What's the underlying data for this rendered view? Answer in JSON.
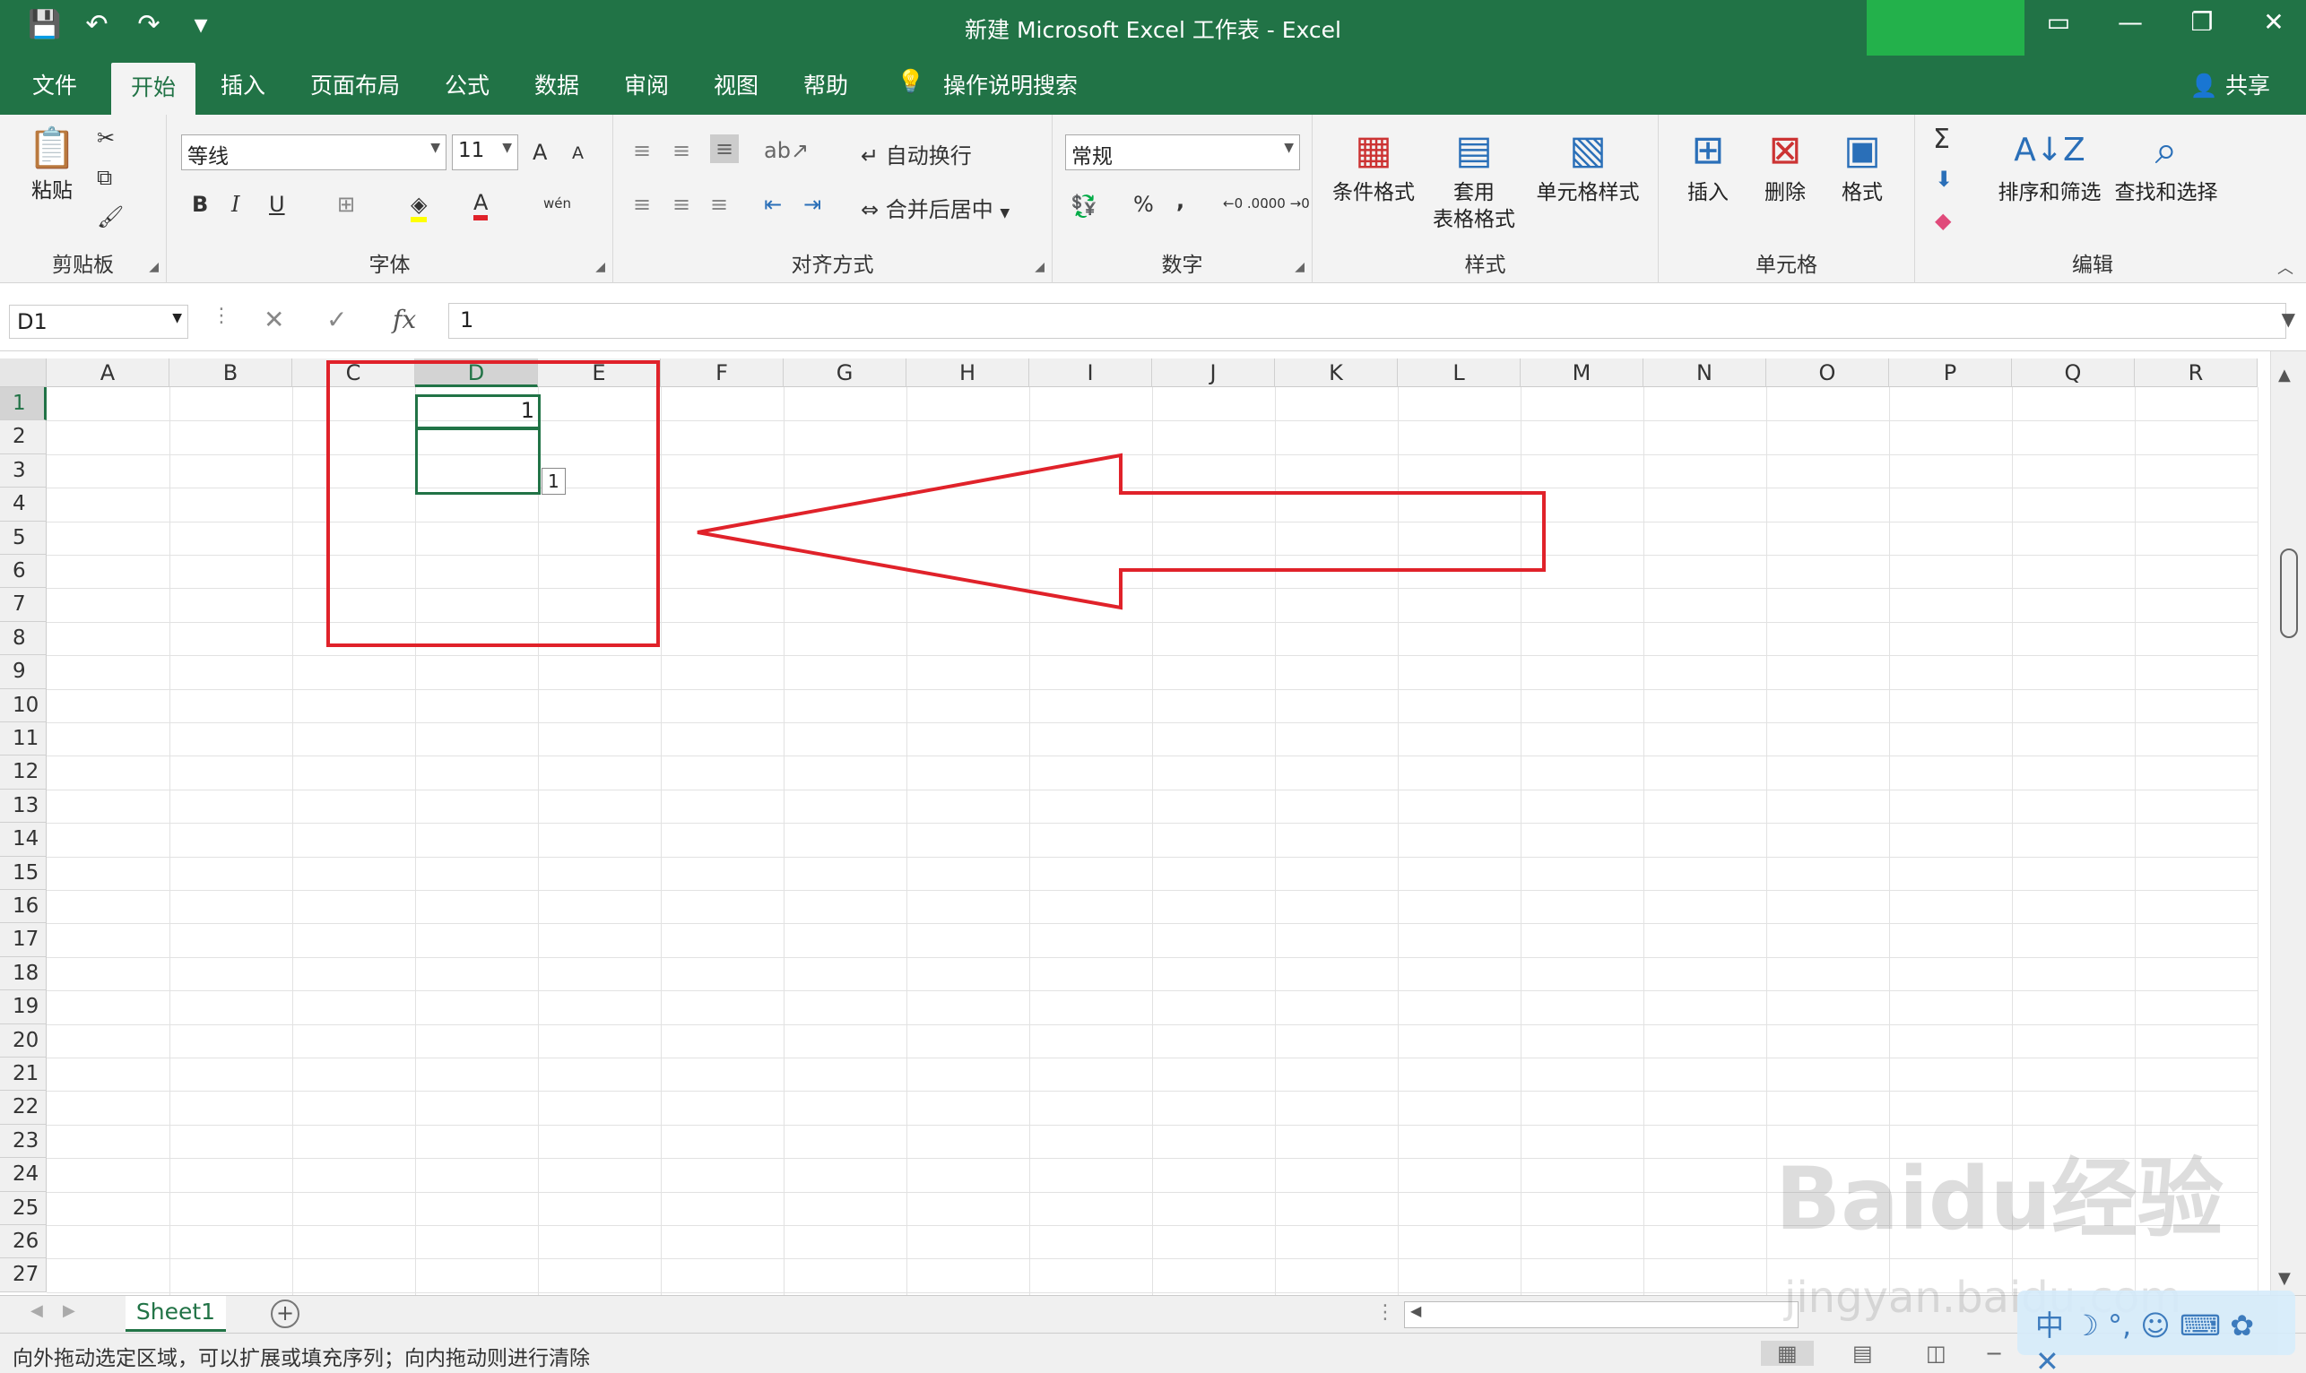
{
  "window": {
    "title": "新建 Microsoft Excel 工作表 - Excel"
  },
  "qat": {
    "save": "save-icon",
    "undo": "undo-icon",
    "redo": "redo-icon",
    "customize": "customize-icon"
  },
  "tabs": [
    "文件",
    "开始",
    "插入",
    "页面布局",
    "公式",
    "数据",
    "审阅",
    "视图",
    "帮助"
  ],
  "search_label": "操作说明搜索",
  "share_label": "共享",
  "ribbon": {
    "clipboard": {
      "label": "剪贴板",
      "paste": "粘贴"
    },
    "font": {
      "label": "字体",
      "name": "等线",
      "size": "11",
      "bold": "B",
      "italic": "I",
      "underline": "U",
      "grow": "A",
      "shrink": "A",
      "color": "A",
      "phonetic": "wén"
    },
    "align": {
      "label": "对齐方式",
      "wrap": "自动换行",
      "merge": "合并后居中"
    },
    "number": {
      "label": "数字",
      "format": "常规",
      "percent": "%",
      "comma": ",",
      "inc": "←0 .00",
      "dec": ".00 →0"
    },
    "styles": {
      "label": "样式",
      "cond": "条件格式",
      "table1": "套用",
      "table2": "表格格式",
      "cell": "单元格样式"
    },
    "cells": {
      "label": "单元格",
      "insert": "插入",
      "delete": "删除",
      "format": "格式"
    },
    "edit": {
      "label": "编辑",
      "sort": "排序和筛选",
      "find": "查找和选择",
      "sum": "Σ"
    }
  },
  "formula_bar": {
    "namebox": "D1",
    "fx": "fx",
    "value": "1"
  },
  "columns": [
    "A",
    "B",
    "C",
    "D",
    "E",
    "F",
    "G",
    "H",
    "I",
    "J",
    "K",
    "L",
    "M",
    "N",
    "O",
    "P",
    "Q",
    "R"
  ],
  "rows": [
    "1",
    "2",
    "3",
    "4",
    "5",
    "6",
    "7",
    "8",
    "9",
    "10",
    "11",
    "12",
    "13",
    "14",
    "15",
    "16",
    "17",
    "18",
    "19",
    "20",
    "21",
    "22",
    "23",
    "24",
    "25",
    "26",
    "27"
  ],
  "cells": {
    "D1": "1"
  },
  "fill_tip": "1",
  "sheet": {
    "name": "Sheet1"
  },
  "status": {
    "text": "向外拖动选定区域，可以扩展或填充序列；向内拖动则进行清除"
  },
  "watermark": {
    "main": "Baidu经验",
    "sub": "jingyan.baidu.com"
  },
  "ime": "中",
  "colors": {
    "accent": "#217346",
    "annotation": "#e0222a"
  }
}
